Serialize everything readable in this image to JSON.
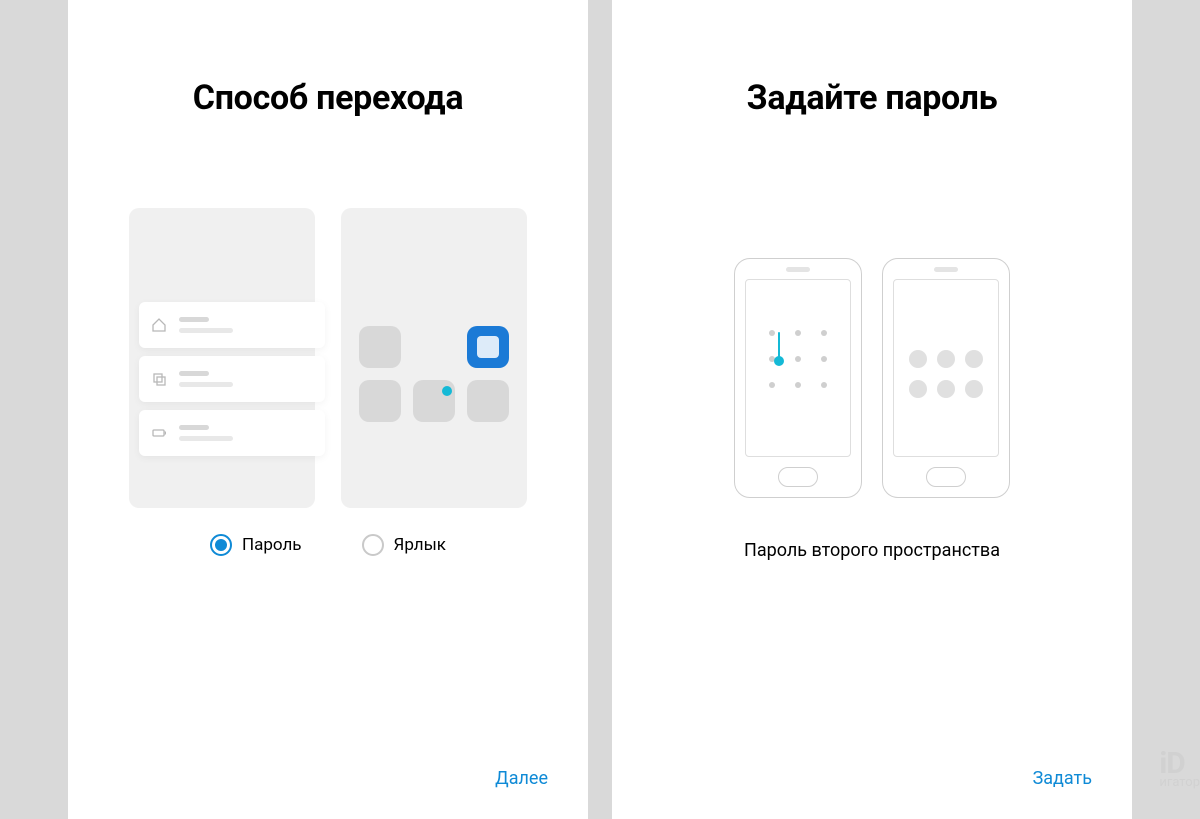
{
  "screen1": {
    "title": "Способ перехода",
    "radios": {
      "password": "Пароль",
      "shortcut": "Ярлык"
    },
    "next": "Далее"
  },
  "screen2": {
    "title": "Задайте пароль",
    "subtitle": "Пароль второго пространства",
    "set": "Задать"
  },
  "watermark": {
    "big": "iD",
    "small": "игатор"
  }
}
